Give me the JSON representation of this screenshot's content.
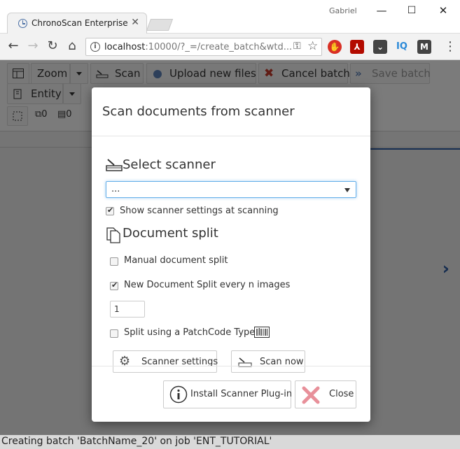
{
  "browser": {
    "tab_title": "ChronoScan Enterprise",
    "profile": "Gabriel",
    "url_host": "localhost",
    "url_rest": ":10000/?_=/create_batch&wtd..."
  },
  "app_toolbar": {
    "zoom_label": "Zoom",
    "scan_label": "Scan",
    "upload_label": "Upload new files",
    "cancel_label": "Cancel batch",
    "save_label": "Save batch",
    "entity_label": "Entity",
    "counter_a": "0",
    "counter_b": "0"
  },
  "modal": {
    "title": "Scan documents from scanner",
    "select_scanner_title": "Select scanner",
    "scanner_value": "...",
    "show_settings_label": "Show scanner settings at scanning",
    "show_settings_checked": true,
    "document_split_title": "Document split",
    "manual_split_label": "Manual document split",
    "manual_split_checked": false,
    "every_n_label": "New Document Split every n images",
    "every_n_checked": true,
    "every_n_value": "1",
    "patchcode_label": "Split using a PatchCode Type I",
    "patchcode_checked": false,
    "scanner_settings_label": "Scanner settings",
    "scan_now_label": "Scan now",
    "install_plugin_label": "Install Scanner Plug-in",
    "close_label": "Close"
  },
  "status_bar": {
    "text": "Creating batch 'BatchName_20' on job 'ENT_TUTORIAL'"
  },
  "colors": {
    "accent": "#2c5aa0",
    "focus": "#66afe9",
    "close_x": "#e8909a",
    "overlay": "rgba(0,0,0,0.5)"
  }
}
